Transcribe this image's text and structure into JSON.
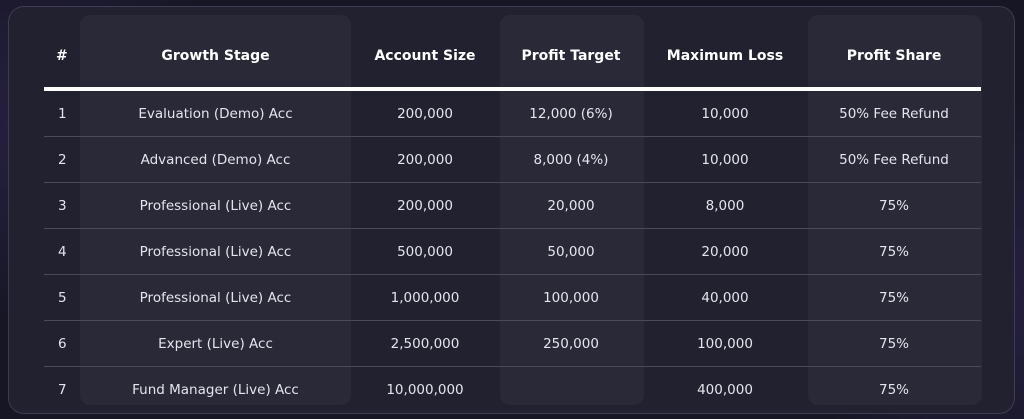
{
  "table": {
    "headers": [
      "#",
      "Growth Stage",
      "Account Size",
      "Profit Target",
      "Maximum Loss",
      "Profit Share"
    ],
    "rows": [
      [
        "1",
        "Evaluation (Demo) Acc",
        "200,000",
        "12,000 (6%)",
        "10,000",
        "50% Fee Refund"
      ],
      [
        "2",
        "Advanced (Demo) Acc",
        "200,000",
        "8,000 (4%)",
        "10,000",
        "50% Fee Refund"
      ],
      [
        "3",
        "Professional (Live) Acc",
        "200,000",
        "20,000",
        "8,000",
        "75%"
      ],
      [
        "4",
        "Professional (Live) Acc",
        "500,000",
        "50,000",
        "20,000",
        "75%"
      ],
      [
        "5",
        "Professional (Live) Acc",
        "1,000,000",
        "100,000",
        "40,000",
        "75%"
      ],
      [
        "6",
        "Expert (Live) Acc",
        "2,500,000",
        "250,000",
        "100,000",
        "75%"
      ],
      [
        "7",
        "Fund Manager (Live) Acc",
        "10,000,000",
        "",
        "400,000",
        "75%"
      ]
    ]
  },
  "colors": {
    "page_bg": "#161624",
    "panel_bg": "#22212f",
    "column_shade": "#2a2938",
    "header_text": "#ffffff",
    "divider": "#ffffff",
    "row_border": "#4a4a5c"
  }
}
